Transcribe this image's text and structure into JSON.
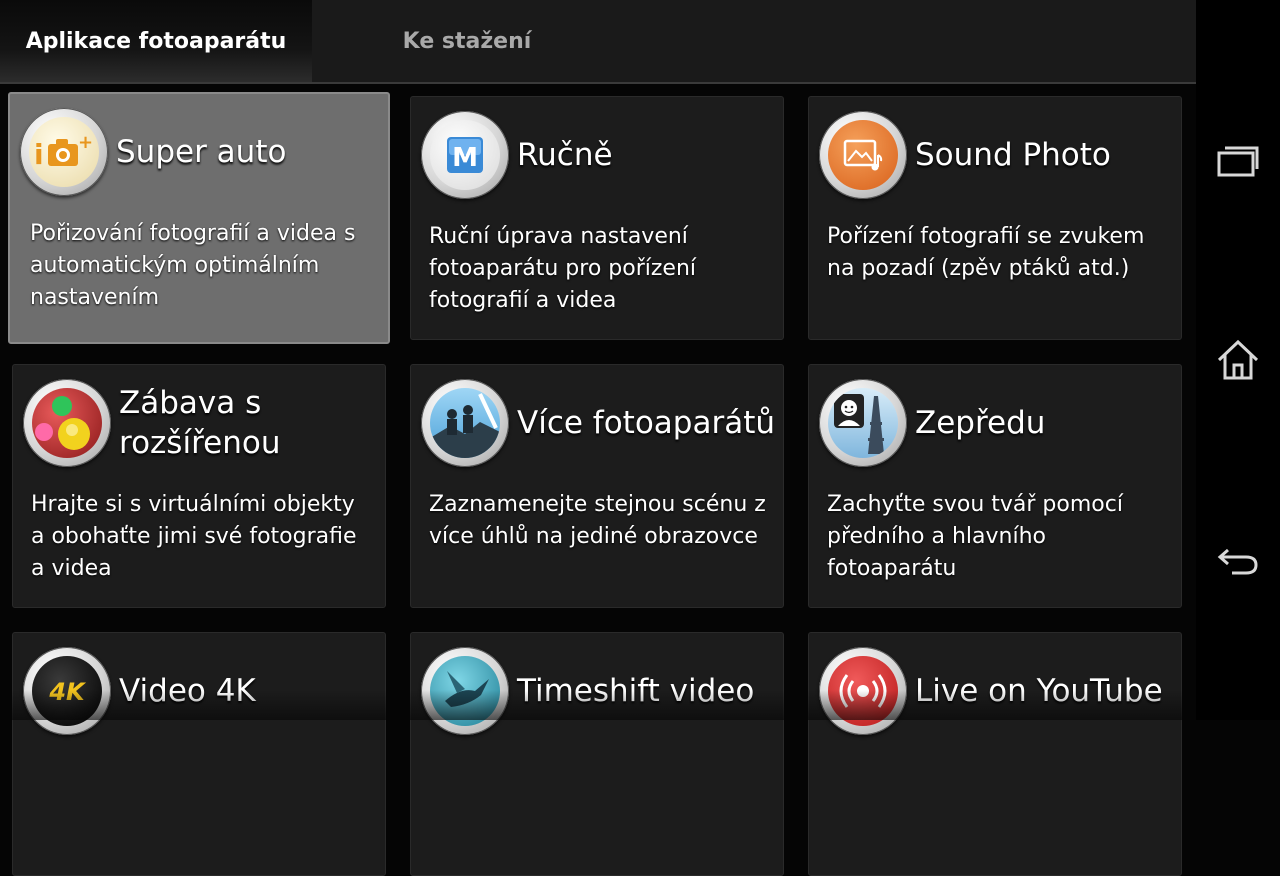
{
  "tabs": [
    {
      "label": "Aplikace fotoaparátu",
      "active": true
    },
    {
      "label": "Ke stažení",
      "active": false
    }
  ],
  "apps": [
    {
      "title": "Super auto",
      "description": "Pořizování fotografií a videa s automatickým optimálním nastavením",
      "icon": "super-auto-icon"
    },
    {
      "title": "Ručně",
      "description": "Ruční úprava nastavení fotoaparátu pro pořízení fotografií a videa",
      "icon": "manual-icon"
    },
    {
      "title": "Sound Photo",
      "description": "Pořízení fotografií se zvukem na pozadí (zpěv ptáků atd.)",
      "icon": "sound-photo-icon"
    },
    {
      "title": "Zábava s rozšířenou",
      "description": "Hrajte si s virtuálními objekty a obohaťte jimi své fotografie a videa",
      "icon": "ar-fun-icon"
    },
    {
      "title": "Více fotoaparátů",
      "description": "Zaznamenejte stejnou scénu z více úhlů na jediné obrazovce",
      "icon": "multi-camera-icon"
    },
    {
      "title": "Zepředu",
      "description": "Zachyťte svou tvář pomocí předního a hlavního fotoaparátu",
      "icon": "face-in-picture-icon"
    },
    {
      "title": "Video 4K",
      "description": "",
      "icon": "video-4k-icon"
    },
    {
      "title": "Timeshift video",
      "description": "",
      "icon": "timeshift-video-icon"
    },
    {
      "title": "Live on YouTube",
      "description": "",
      "icon": "live-youtube-icon"
    }
  ],
  "nav": {
    "recent_apps": "recent-apps-icon",
    "home": "home-icon",
    "back": "back-icon"
  },
  "colors": {
    "background": "#050505",
    "card": "#1c1c1c",
    "selected_card": "#6e6e6e",
    "accent_orange": "#e8761e",
    "live_red": "#d92b2b"
  }
}
